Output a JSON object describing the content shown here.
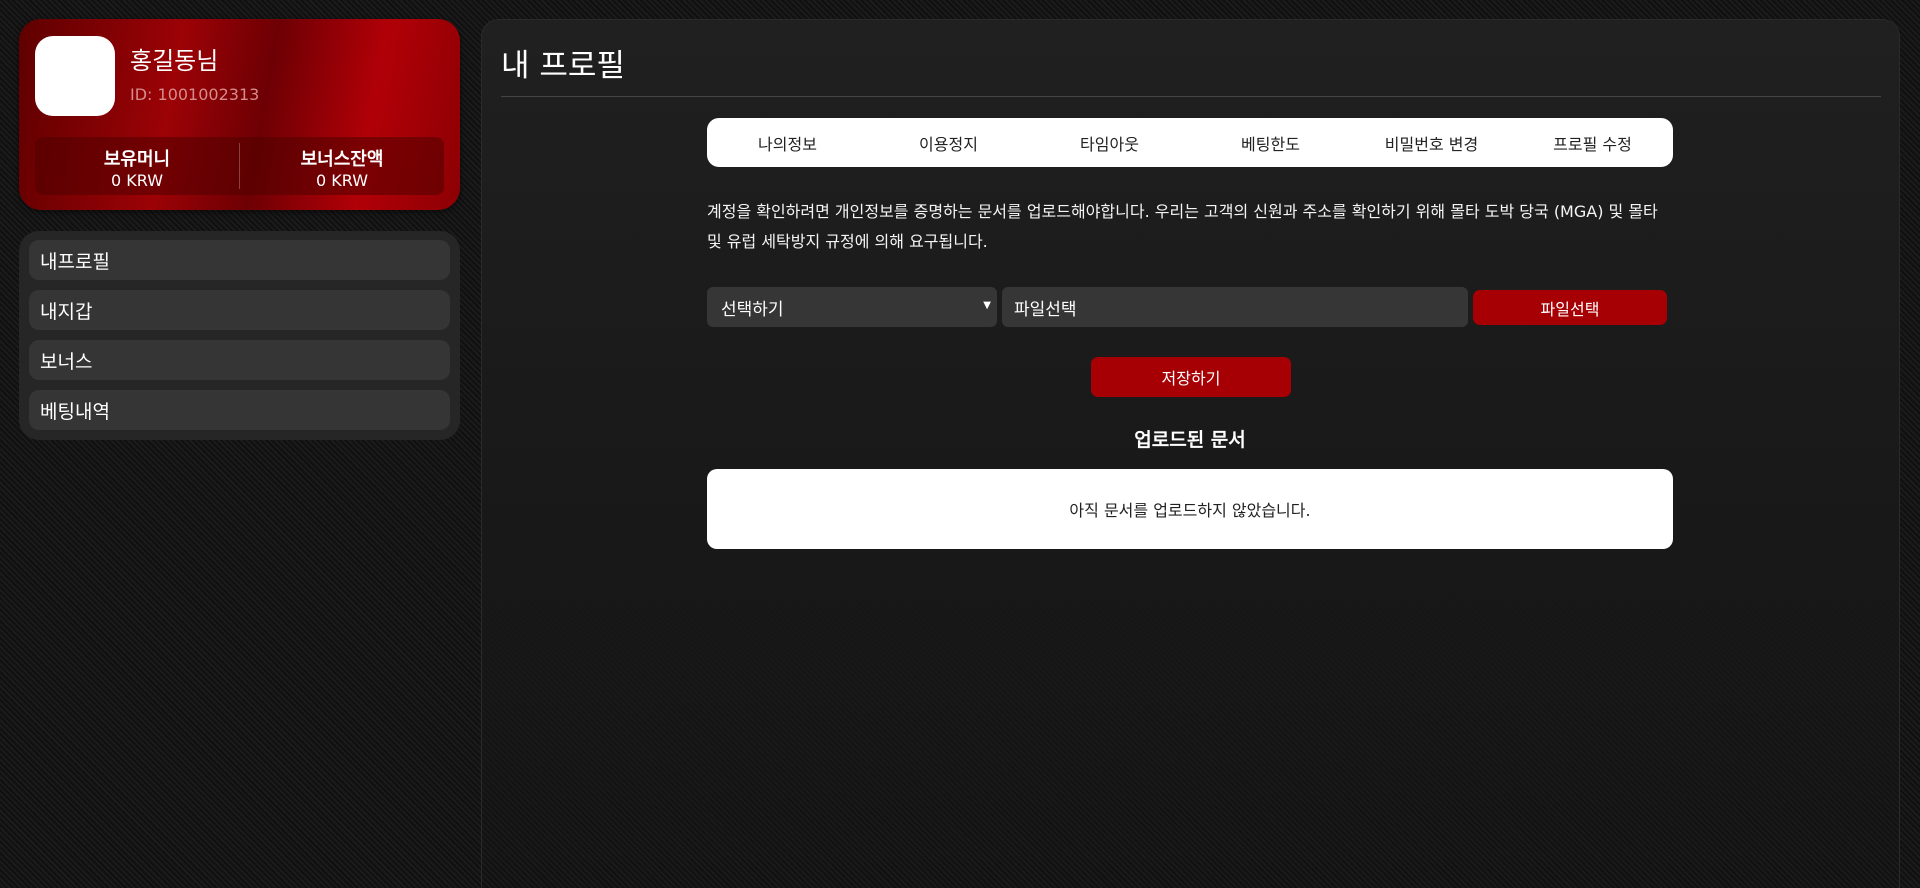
{
  "user": {
    "name": "홍길동님",
    "id_text": "ID: 1001002313"
  },
  "balances": [
    {
      "label": "보유머니",
      "value": "0 KRW"
    },
    {
      "label": "보너스잔액",
      "value": "0 KRW"
    }
  ],
  "sidebar": {
    "items": [
      {
        "label": "내프로필"
      },
      {
        "label": "내지갑"
      },
      {
        "label": "보너스"
      },
      {
        "label": "베팅내역"
      }
    ]
  },
  "main": {
    "title": "내 프로필",
    "tabs": [
      {
        "label": "나의정보"
      },
      {
        "label": "이용정지"
      },
      {
        "label": "타임아웃"
      },
      {
        "label": "베팅한도"
      },
      {
        "label": "비밀번호 변경"
      },
      {
        "label": "프로필 수정"
      }
    ],
    "notice_line1": "계정을 확인하려면 개인정보를 증명하는 문서를 업로드해야합니다. 우리는 고객의 신원과 주소를 확인하기 위해 몰타 도박 당국 (MGA) 및 몰타",
    "notice_line2": "및 유럽 세탁방지 규정에 의해 요구됩니다.",
    "doc_select_value": "선택하기",
    "file_field_value": "파일선택",
    "file_button_label": "파일선택",
    "save_button_label": "저장하기",
    "uploaded_heading": "업로드된 문서",
    "uploaded_empty_text": "아직 문서를 업로드하지 않았습니다."
  },
  "colors": {
    "accent": "#a70004",
    "panel": "#262626"
  }
}
